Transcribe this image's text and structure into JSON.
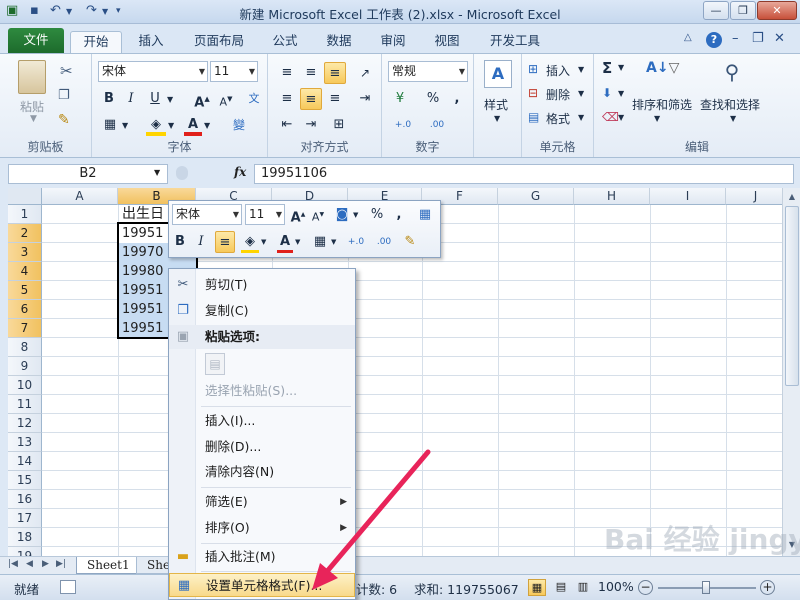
{
  "window": {
    "title": "新建 Microsoft Excel 工作表 (2).xlsx  -  Microsoft Excel"
  },
  "tabs": [
    "文件",
    "开始",
    "插入",
    "页面布局",
    "公式",
    "数据",
    "审阅",
    "视图",
    "开发工具"
  ],
  "ribbon": {
    "clipboard": {
      "paste": "粘贴",
      "group": "剪贴板"
    },
    "font": {
      "name": "宋体",
      "size": "11",
      "bold": "B",
      "italic": "I",
      "underline": "U",
      "group": "字体"
    },
    "alignment": {
      "group": "对齐方式"
    },
    "number": {
      "format": "常规",
      "percent": "%",
      "comma": ",",
      "group": "数字"
    },
    "styles": {
      "label": "样式"
    },
    "cells": {
      "insert": "插入",
      "delete": "删除",
      "format": "格式",
      "group": "单元格"
    },
    "editing": {
      "sort": "排序和筛选",
      "find": "查找和选择",
      "sigma": "Σ",
      "group": "编辑"
    }
  },
  "formula_bar": {
    "name_box": "B2",
    "fx": "fx",
    "value": "19951106"
  },
  "columns": [
    "A",
    "B",
    "C",
    "D",
    "E",
    "F",
    "G",
    "H",
    "I",
    "J"
  ],
  "rows": [
    "1",
    "2",
    "3",
    "4",
    "5",
    "6",
    "7",
    "8",
    "9",
    "10",
    "11",
    "12",
    "13",
    "14",
    "15",
    "16",
    "17",
    "18",
    "19"
  ],
  "cells": {
    "b1": "出生日",
    "b2": "19951",
    "b3": "19970",
    "b4": "19980",
    "b5": "19951",
    "b6": "19951",
    "b7": "19951"
  },
  "mini_toolbar": {
    "font": "宋体",
    "size": "11",
    "percent": "%",
    "comma": ",",
    "bold": "B",
    "italic": "I"
  },
  "context_menu": {
    "cut": "剪切(T)",
    "copy": "复制(C)",
    "paste_options": "粘贴选项:",
    "paste_special": "选择性粘贴(S)...",
    "insert": "插入(I)...",
    "delete": "删除(D)...",
    "clear": "清除内容(N)",
    "filter": "筛选(E)",
    "sort": "排序(O)",
    "insert_comment": "插入批注(M)",
    "format_cells": "设置单元格格式(F)..."
  },
  "sheets": [
    "Sheet1",
    "Shee"
  ],
  "status": {
    "ready": "就绪",
    "count": "计数: 6",
    "sum": "求和: 119755067",
    "zoom": "100%"
  },
  "watermark": "Bai 经验 jingyan.baidu.com",
  "colors": {
    "accent": "#2d6cc0",
    "file_tab": "#1d6b2c",
    "arrow": "#e8245a",
    "selection": "#c7dcf2"
  }
}
